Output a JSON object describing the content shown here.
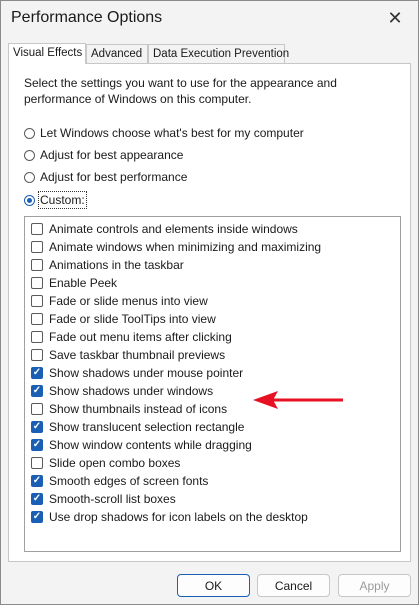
{
  "window": {
    "title": "Performance Options"
  },
  "tabs": [
    {
      "label": "Visual Effects",
      "active": true
    },
    {
      "label": "Advanced",
      "active": false
    },
    {
      "label": "Data Execution Prevention",
      "active": false
    }
  ],
  "description": "Select the settings you want to use for the appearance and performance of Windows on this computer.",
  "radios": [
    {
      "label": "Let Windows choose what's best for my computer",
      "checked": false
    },
    {
      "label": "Adjust for best appearance",
      "checked": false
    },
    {
      "label": "Adjust for best performance",
      "checked": false
    },
    {
      "label": "Custom:",
      "checked": true
    }
  ],
  "effects": [
    {
      "label": "Animate controls and elements inside windows",
      "checked": false
    },
    {
      "label": "Animate windows when minimizing and maximizing",
      "checked": false
    },
    {
      "label": "Animations in the taskbar",
      "checked": false
    },
    {
      "label": "Enable Peek",
      "checked": false
    },
    {
      "label": "Fade or slide menus into view",
      "checked": false
    },
    {
      "label": "Fade or slide ToolTips into view",
      "checked": false
    },
    {
      "label": "Fade out menu items after clicking",
      "checked": false
    },
    {
      "label": "Save taskbar thumbnail previews",
      "checked": false
    },
    {
      "label": "Show shadows under mouse pointer",
      "checked": true
    },
    {
      "label": "Show shadows under windows",
      "checked": true
    },
    {
      "label": "Show thumbnails instead of icons",
      "checked": false
    },
    {
      "label": "Show translucent selection rectangle",
      "checked": true
    },
    {
      "label": "Show window contents while dragging",
      "checked": true
    },
    {
      "label": "Slide open combo boxes",
      "checked": false
    },
    {
      "label": "Smooth edges of screen fonts",
      "checked": true
    },
    {
      "label": "Smooth-scroll list boxes",
      "checked": true
    },
    {
      "label": "Use drop shadows for icon labels on the desktop",
      "checked": true
    }
  ],
  "buttons": {
    "ok": "OK",
    "cancel": "Cancel",
    "apply": "Apply"
  },
  "colors": {
    "accent": "#1a5fb4",
    "arrow": "#e81123"
  },
  "icons": {
    "close": "close-icon",
    "annotation": "red-arrow-icon"
  }
}
